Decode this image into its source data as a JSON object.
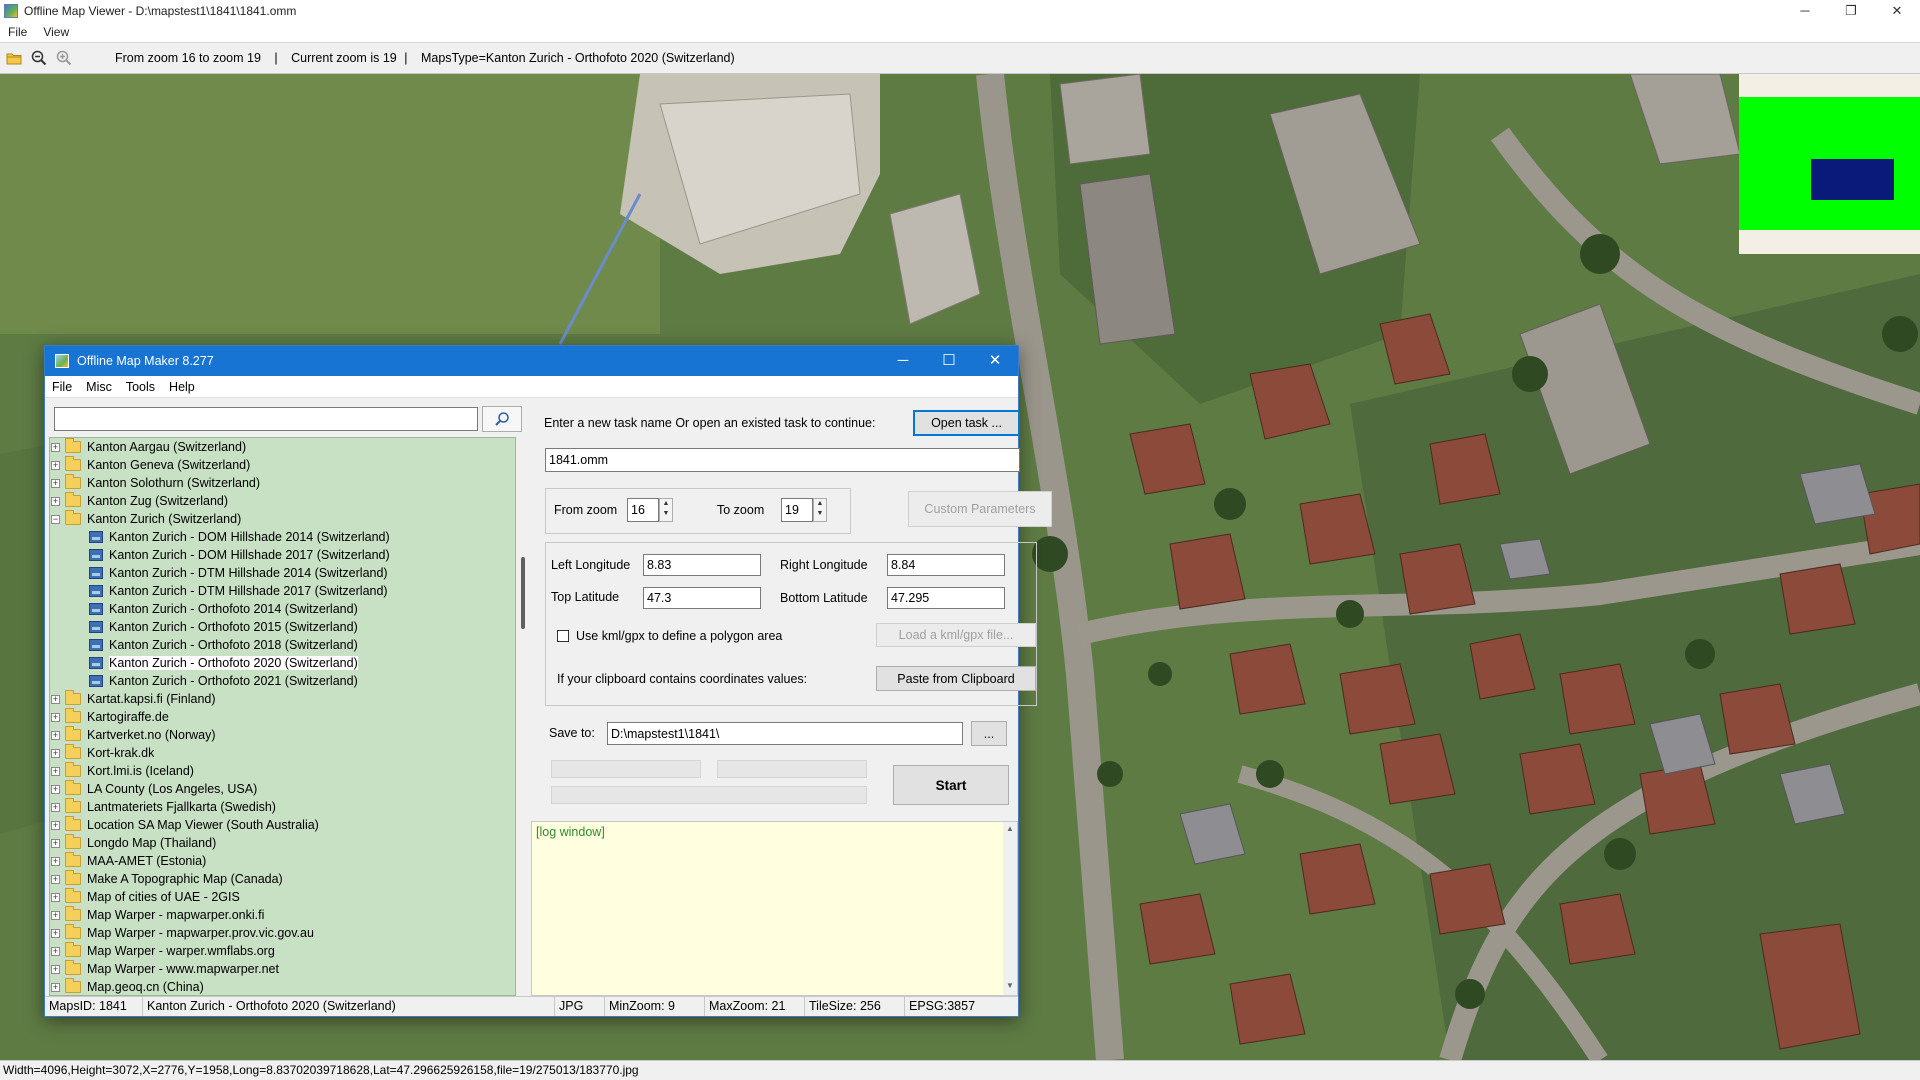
{
  "viewer": {
    "title": "Offline Map Viewer - D:\\mapstest1\\1841\\1841.omm",
    "window_controls": {
      "minimize": "─",
      "restore": "❐",
      "close": "✕"
    },
    "menu": [
      "File",
      "View"
    ],
    "toolbar": {
      "zoom_range": "From zoom 16 to zoom 19",
      "sep1": "|",
      "current_zoom": "Current zoom is 19",
      "sep2": "|",
      "maps_type": "MapsType=Kanton Zurich - Orthofoto 2020 (Switzerland)"
    },
    "status": "Width=4096,Height=3072,X=2776,Y=1958,Long=8.83702039718628,Lat=47.296625926158,file=19/275013/183770.jpg",
    "overview_colors": {
      "background": "#f3efe4",
      "area": "#00ff00",
      "viewport": "#0a1a7a"
    }
  },
  "map_maker": {
    "title": "Offline Map Maker 8.277",
    "window_controls": {
      "minimize": "─",
      "maximize": "☐",
      "close": "✕"
    },
    "menu": [
      "File",
      "Misc",
      "Tools",
      "Help"
    ],
    "search": {
      "value": "",
      "button_icon": "magnifier-icon"
    },
    "tree": [
      {
        "label": "Kanton Aargau (Switzerland)",
        "expanded": false
      },
      {
        "label": "Kanton Geneva (Switzerland)",
        "expanded": false
      },
      {
        "label": "Kanton Solothurn (Switzerland)",
        "expanded": false
      },
      {
        "label": "Kanton Zug (Switzerland)",
        "expanded": false
      },
      {
        "label": "Kanton Zurich (Switzerland)",
        "expanded": true,
        "children": [
          {
            "label": "Kanton Zurich - DOM Hillshade 2014 (Switzerland)"
          },
          {
            "label": "Kanton Zurich - DOM Hillshade 2017 (Switzerland)"
          },
          {
            "label": "Kanton Zurich - DTM Hillshade 2014 (Switzerland)"
          },
          {
            "label": "Kanton Zurich - DTM Hillshade 2017 (Switzerland)"
          },
          {
            "label": "Kanton Zurich - Orthofoto 2014 (Switzerland)"
          },
          {
            "label": "Kanton Zurich - Orthofoto 2015 (Switzerland)"
          },
          {
            "label": "Kanton Zurich - Orthofoto 2018 (Switzerland)"
          },
          {
            "label": "Kanton Zurich - Orthofoto 2020 (Switzerland)",
            "selected": true
          },
          {
            "label": "Kanton Zurich - Orthofoto 2021 (Switzerland)"
          }
        ]
      },
      {
        "label": "Kartat.kapsi.fi (Finland)",
        "expanded": false
      },
      {
        "label": "Kartogiraffe.de",
        "expanded": false
      },
      {
        "label": "Kartverket.no (Norway)",
        "expanded": false
      },
      {
        "label": "Kort-krak.dk",
        "expanded": false
      },
      {
        "label": "Kort.lmi.is (Iceland)",
        "expanded": false
      },
      {
        "label": "LA County (Los Angeles, USA)",
        "expanded": false
      },
      {
        "label": "Lantmateriets Fjallkarta (Swedish)",
        "expanded": false
      },
      {
        "label": "Location SA Map Viewer (South Australia)",
        "expanded": false
      },
      {
        "label": "Longdo Map (Thailand)",
        "expanded": false
      },
      {
        "label": "MAA-AMET (Estonia)",
        "expanded": false
      },
      {
        "label": "Make A Topographic Map (Canada)",
        "expanded": false
      },
      {
        "label": "Map of cities of UAE - 2GIS",
        "expanded": false
      },
      {
        "label": "Map Warper - mapwarper.onki.fi",
        "expanded": false
      },
      {
        "label": "Map Warper - mapwarper.prov.vic.gov.au",
        "expanded": false
      },
      {
        "label": "Map Warper - warper.wmflabs.org",
        "expanded": false
      },
      {
        "label": "Map Warper - www.mapwarper.net",
        "expanded": false
      },
      {
        "label": "Map.geoq.cn (China)",
        "expanded": false
      }
    ],
    "task": {
      "prompt": "Enter a new task name Or open an existed task to continue:",
      "open_button": "Open task ...",
      "name_value": "1841.omm"
    },
    "zoom": {
      "from_label": "From zoom",
      "from_value": "16",
      "to_label": "To zoom",
      "to_value": "19",
      "custom_button": "Custom Parameters"
    },
    "area": {
      "left_lon_label": "Left Longitude",
      "left_lon_value": "8.83",
      "right_lon_label": "Right Longitude",
      "right_lon_value": "8.84",
      "top_lat_label": "Top Latitude",
      "top_lat_value": "47.3",
      "bottom_lat_label": "Bottom Latitude",
      "bottom_lat_value": "47.295",
      "kml_checkbox_label": "Use kml/gpx to define a polygon area",
      "kml_checked": false,
      "load_kml_button": "Load a kml/gpx file...",
      "clipboard_label": "If your clipboard contains coordinates values:",
      "paste_button": "Paste from Clipboard"
    },
    "save": {
      "label": "Save to:",
      "value": "D:\\mapstest1\\1841\\",
      "browse_button": "...",
      "start_button": "Start"
    },
    "log": {
      "text": "[log window]",
      "scroll_up": "▲",
      "scroll_down": "▼"
    },
    "status": {
      "maps_id": "MapsID: 1841",
      "map_name": "Kanton Zurich - Orthofoto 2020 (Switzerland)",
      "format": "JPG",
      "min_zoom": "MinZoom: 9",
      "max_zoom": "MaxZoom: 21",
      "tile_size": "TileSize: 256",
      "epsg": "EPSG:3857"
    }
  }
}
